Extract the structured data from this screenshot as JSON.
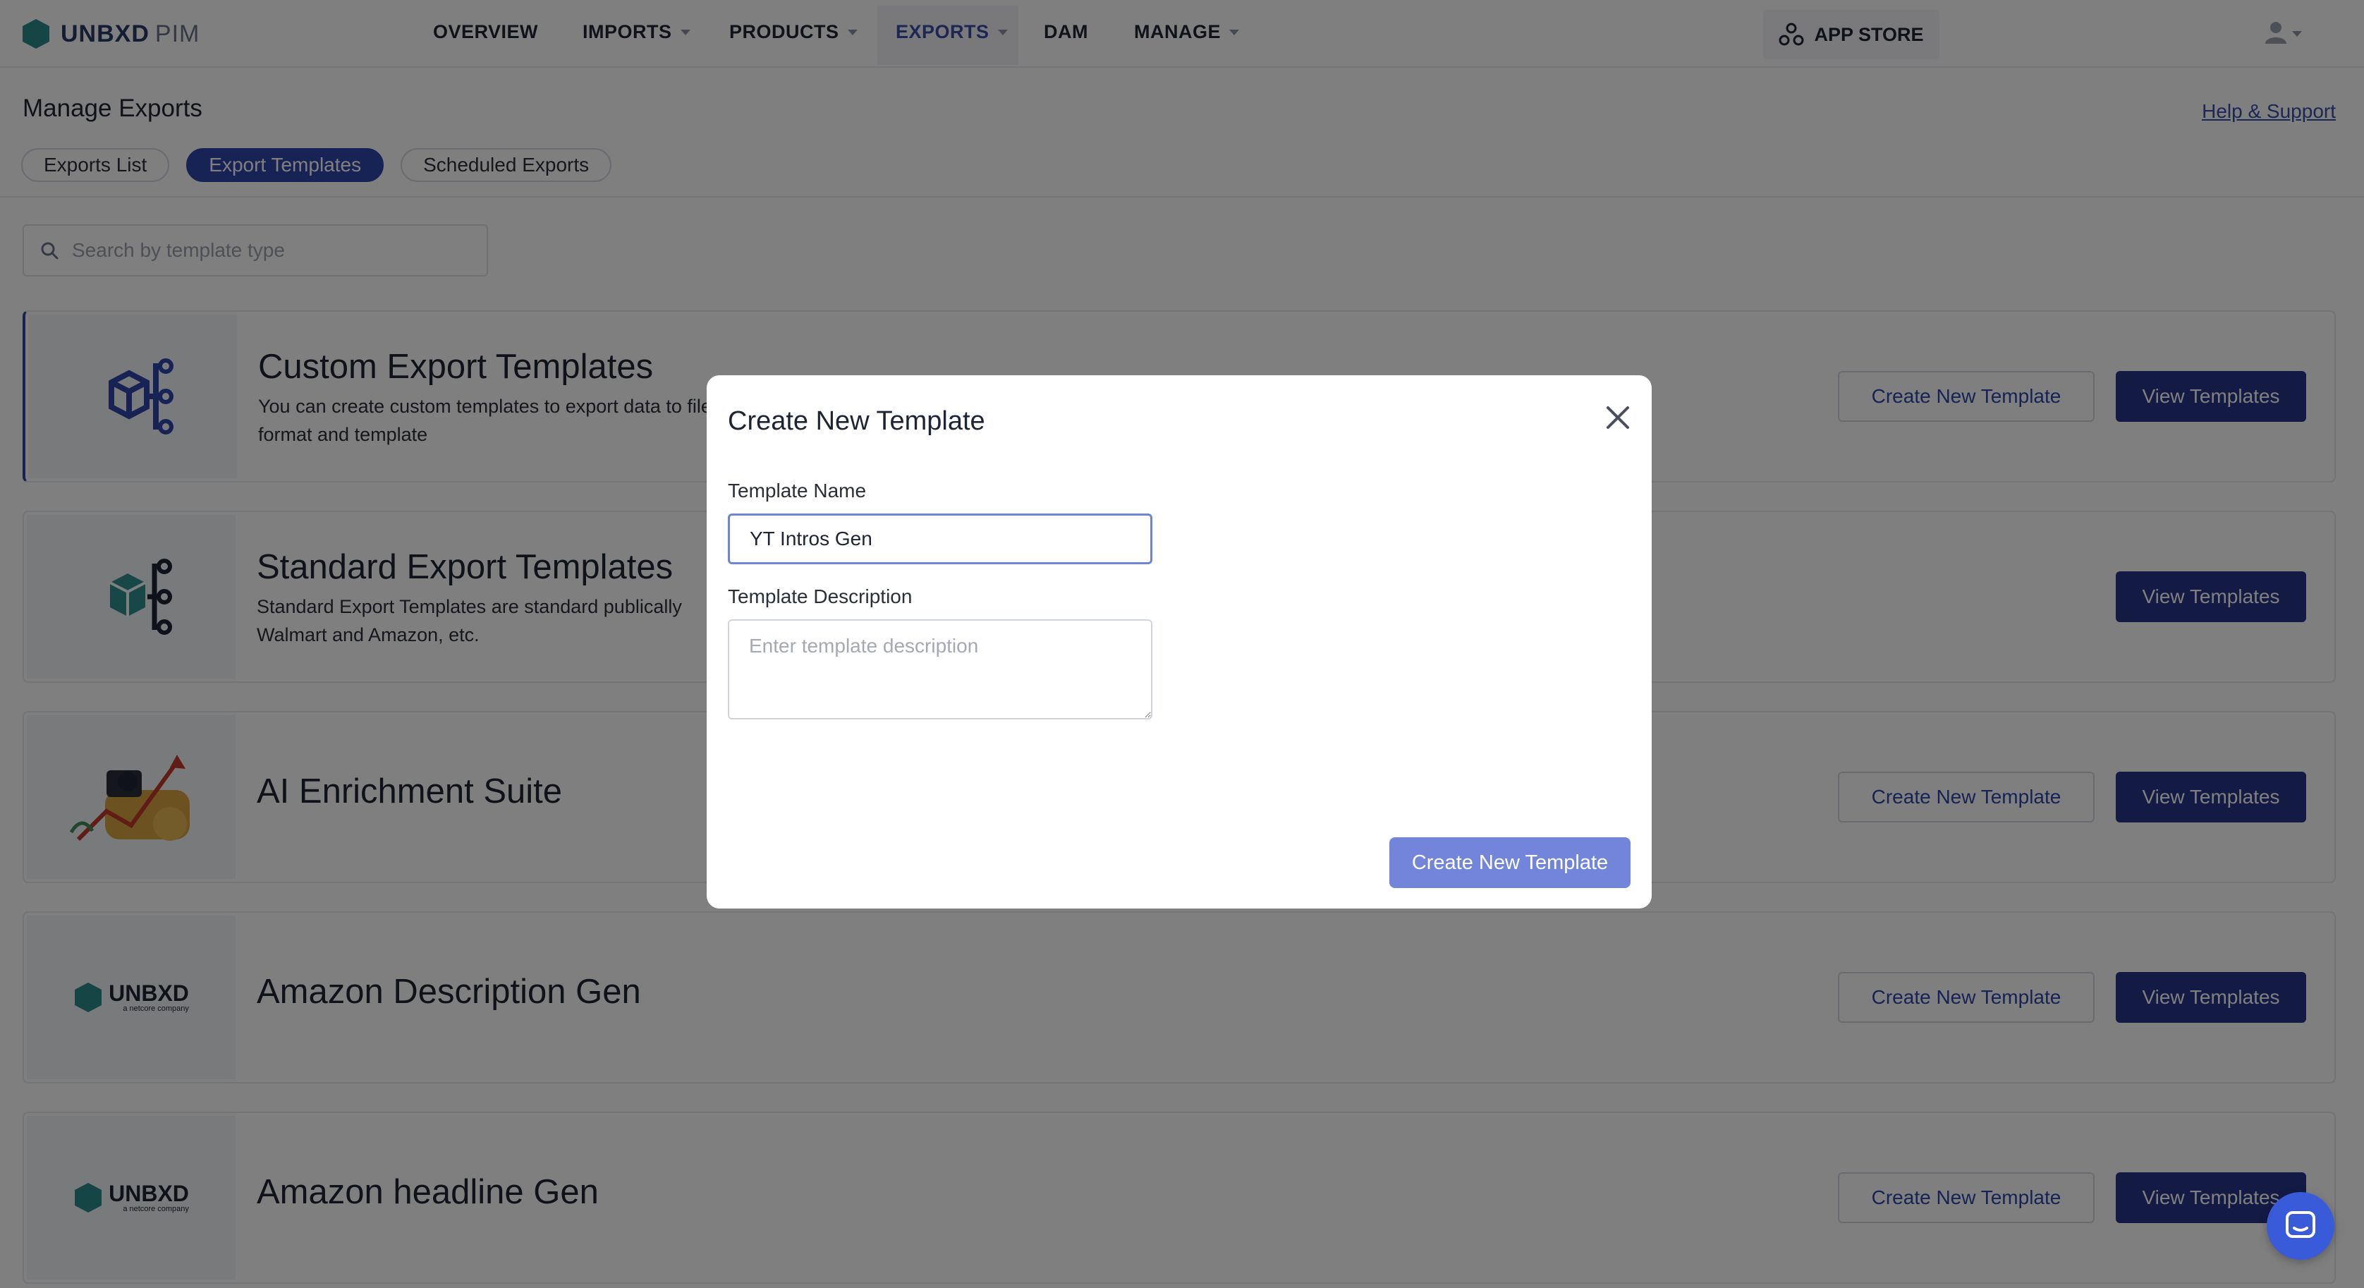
{
  "brand": {
    "name": "UNBXD",
    "product": "PIM"
  },
  "nav": {
    "items": [
      {
        "label": "OVERVIEW",
        "has_menu": false
      },
      {
        "label": "IMPORTS",
        "has_menu": true
      },
      {
        "label": "PRODUCTS",
        "has_menu": true
      },
      {
        "label": "EXPORTS",
        "has_menu": true,
        "active": true
      },
      {
        "label": "DAM",
        "has_menu": false
      },
      {
        "label": "MANAGE",
        "has_menu": true
      }
    ],
    "app_store": "APP STORE"
  },
  "page": {
    "title": "Manage Exports",
    "help_link": "Help & Support",
    "tabs": [
      {
        "label": "Exports List",
        "active": false
      },
      {
        "label": "Export Templates",
        "active": true
      },
      {
        "label": "Scheduled Exports",
        "active": false
      }
    ],
    "search": {
      "placeholder": "Search by template type",
      "value": ""
    }
  },
  "cards": [
    {
      "title": "Custom Export Templates",
      "description": "You can create custom templates to export data to file format and template",
      "icon": "cube-tree-icon",
      "create_label": "Create New Template",
      "view_label": "View Templates"
    },
    {
      "title": "Standard Export Templates",
      "description": "Standard Export Templates are standard publically Walmart and Amazon, etc.",
      "icon": "cube-tree-icon",
      "create_label": "",
      "view_label": "View Templates"
    },
    {
      "title": "AI Enrichment Suite",
      "description": "",
      "icon": "ai-enrichment-illustration",
      "create_label": "Create New Template",
      "view_label": "View Templates"
    },
    {
      "title": "Amazon Description Gen",
      "description": "",
      "icon": "unbxd-logo",
      "create_label": "Create New Template",
      "view_label": "View Templates"
    },
    {
      "title": "Amazon headline Gen",
      "description": "",
      "icon": "unbxd-logo",
      "create_label": "Create New Template",
      "view_label": "View Templates"
    }
  ],
  "card_logo": {
    "wordmark": "UNBXD",
    "tagline": "a netcore company"
  },
  "modal": {
    "title": "Create New Template",
    "name_label": "Template Name",
    "name_value": "YT Intros Gen",
    "description_label": "Template Description",
    "description_placeholder": "Enter template description",
    "description_value": "",
    "submit_label": "Create New Template"
  },
  "colors": {
    "primary": "#2f46a8",
    "primary_dark": "#26378a",
    "modal_button": "#7285da",
    "icon_teal": "#2f8f8f",
    "chat": "#3a5bd9"
  }
}
